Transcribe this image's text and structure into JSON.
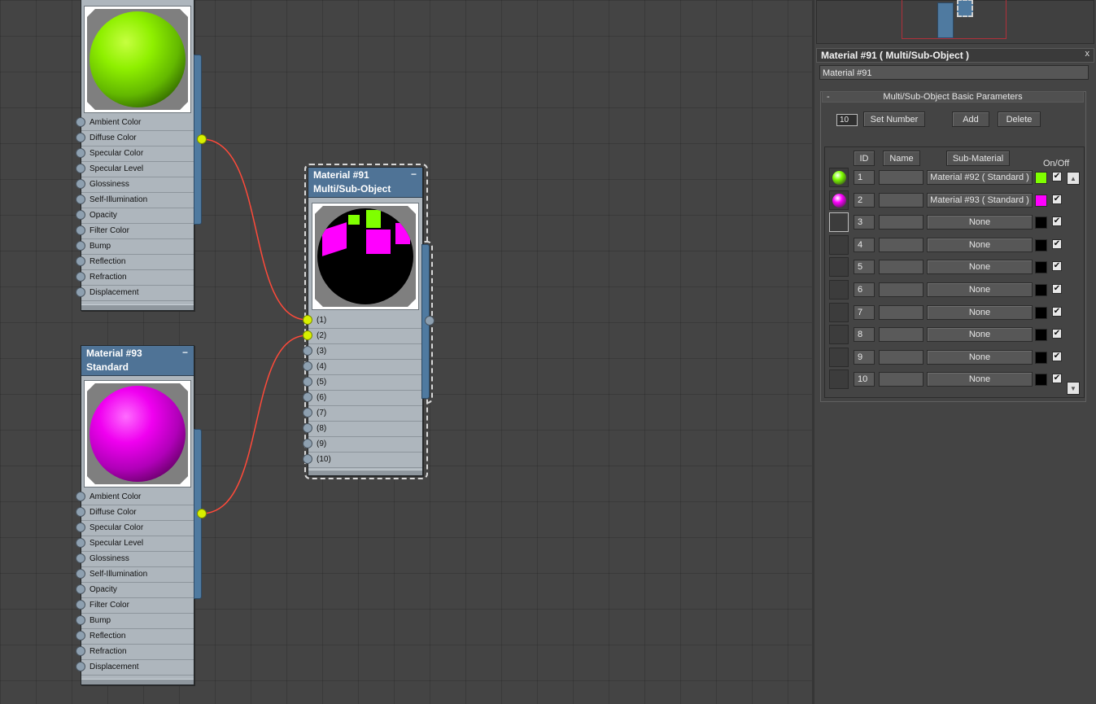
{
  "node_top": {
    "slots": [
      "Ambient Color",
      "Diffuse Color",
      "Specular Color",
      "Specular Level",
      "Glossiness",
      "Self-Illumination",
      "Opacity",
      "Filter Color",
      "Bump",
      "Reflection",
      "Refraction",
      "Displacement"
    ],
    "sphere_color": "#7fff00"
  },
  "node_bottom": {
    "title_line1": "Material #93",
    "title_line2": "Standard",
    "min_glyph": "−",
    "slots": [
      "Ambient Color",
      "Diffuse Color",
      "Specular Color",
      "Specular Level",
      "Glossiness",
      "Self-Illumination",
      "Opacity",
      "Filter Color",
      "Bump",
      "Reflection",
      "Refraction",
      "Displacement"
    ],
    "sphere_color": "#ff00ff"
  },
  "node_multi": {
    "title_line1": "Material #91",
    "title_line2": "Multi/Sub-Object",
    "min_glyph": "−",
    "slots": [
      "(1)",
      "(2)",
      "(3)",
      "(4)",
      "(5)",
      "(6)",
      "(7)",
      "(8)",
      "(9)",
      "(10)"
    ]
  },
  "panel": {
    "title": "Material #91  ( Multi/Sub-Object )",
    "close_glyph": "x",
    "name_value": "Material #91",
    "rollout_toggle": "-",
    "rollout_title": "Multi/Sub-Object Basic Parameters",
    "count_value": "10",
    "set_number_label": "Set Number",
    "add_label": "Add",
    "delete_label": "Delete",
    "headers": {
      "id": "ID",
      "name": "Name",
      "sub_material": "Sub-Material",
      "on_off": "On/Off"
    },
    "check_glyph": "✔",
    "rows": [
      {
        "id": "1",
        "sub": "Material #92  ( Standard )",
        "color": "#7fff00",
        "ball": "#7fff00"
      },
      {
        "id": "2",
        "sub": "Material #93  ( Standard )",
        "color": "#ff00ff",
        "ball": "#ff00ff"
      },
      {
        "id": "3",
        "sub": "None",
        "color": "#000000",
        "ball": ""
      },
      {
        "id": "4",
        "sub": "None",
        "color": "#000000",
        "ball": ""
      },
      {
        "id": "5",
        "sub": "None",
        "color": "#000000",
        "ball": ""
      },
      {
        "id": "6",
        "sub": "None",
        "color": "#000000",
        "ball": ""
      },
      {
        "id": "7",
        "sub": "None",
        "color": "#000000",
        "ball": ""
      },
      {
        "id": "8",
        "sub": "None",
        "color": "#000000",
        "ball": ""
      },
      {
        "id": "9",
        "sub": "None",
        "color": "#000000",
        "ball": ""
      },
      {
        "id": "10",
        "sub": "None",
        "color": "#000000",
        "ball": ""
      }
    ]
  },
  "colors": {
    "wire": "#ff4a3a",
    "socket_active": "#d8f000",
    "node_header": "#4f7396"
  }
}
